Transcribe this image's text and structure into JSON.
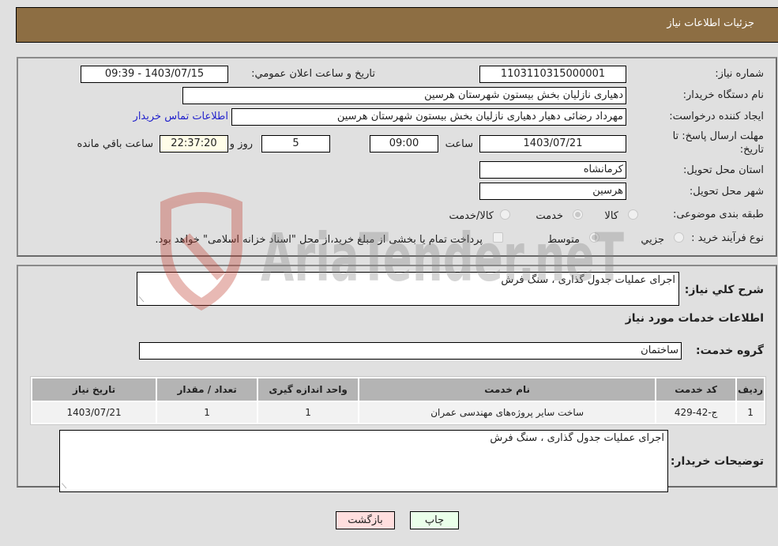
{
  "header": {
    "title": "جزئیات اطلاعات نیاز"
  },
  "info": {
    "need_number_label": "شماره نیاز:",
    "need_number": "1103110315000001",
    "announce_label": "تاریخ و ساعت اعلان عمومي:",
    "announce_value": "1403/07/15 - 09:39",
    "buyer_org_label": "نام دستگاه خریدار:",
    "buyer_org": "دهیاری نازلیان بخش بیستون شهرستان هرسین",
    "creator_label": "ایجاد کننده درخواست:",
    "creator": "مهرداد رضائی دهیار دهیاری نازلیان بخش بیستون شهرستان هرسین",
    "contact_link": "اطلاعات تماس خریدار",
    "deadline_label_line1": "مهلت ارسال پاسخ: تا",
    "deadline_label_line2": "تاریخ:",
    "deadline_date": "1403/07/21",
    "time_label": "ساعت",
    "deadline_time": "09:00",
    "days_value": "5",
    "days_label": "روز و",
    "remaining_time": "22:37:20",
    "remaining_label": "ساعت باقي مانده",
    "province_label": "استان محل تحویل:",
    "province": "کرمانشاه",
    "city_label": "شهر محل تحویل:",
    "city": "هرسین",
    "category_label": "طبقه بندی موضوعی:",
    "category_options": [
      {
        "label": "کالا",
        "checked": false
      },
      {
        "label": "خدمت",
        "checked": true
      },
      {
        "label": "کالا/خدمت",
        "checked": false
      }
    ],
    "process_label": "نوع فرآیند خرید :",
    "process_options": [
      {
        "label": "جزيي",
        "checked": false
      },
      {
        "label": "متوسط",
        "checked": true
      }
    ],
    "treasury_note": "پرداخت تمام یا بخشی از مبلغ خرید،از محل \"اسناد خزانه اسلامی\" خواهد بود."
  },
  "details": {
    "description_label": "شرح کلي نیاز:",
    "description": "اجرای عملیات جدول گذاری ، سنگ فرش",
    "services_heading": "اطلاعات خدمات مورد نیاز",
    "service_group_label": "گروه خدمت:",
    "service_group": "ساختمان",
    "table": {
      "headers": [
        "ردیف",
        "کد خدمت",
        "نام خدمت",
        "واحد اندازه گیری",
        "تعداد / مقدار",
        "تاریخ نیاز"
      ],
      "rows": [
        [
          "1",
          "ج-42-429",
          "ساخت سایر پروژه‌های مهندسی عمران",
          "1",
          "1",
          "1403/07/21"
        ]
      ]
    },
    "buyer_notes_label": "توضیحات خریدار:",
    "buyer_notes": "اجرای عملیات جدول گذاری ، سنگ فرش"
  },
  "buttons": {
    "print": "چاپ",
    "back": "بازگشت"
  },
  "watermark": {
    "text": "AriaTender.neT"
  },
  "colors": {
    "header_bg": "#8d6e43",
    "link": "#2222cc",
    "print_bg": "#eaffea",
    "back_bg": "#ffdede"
  }
}
